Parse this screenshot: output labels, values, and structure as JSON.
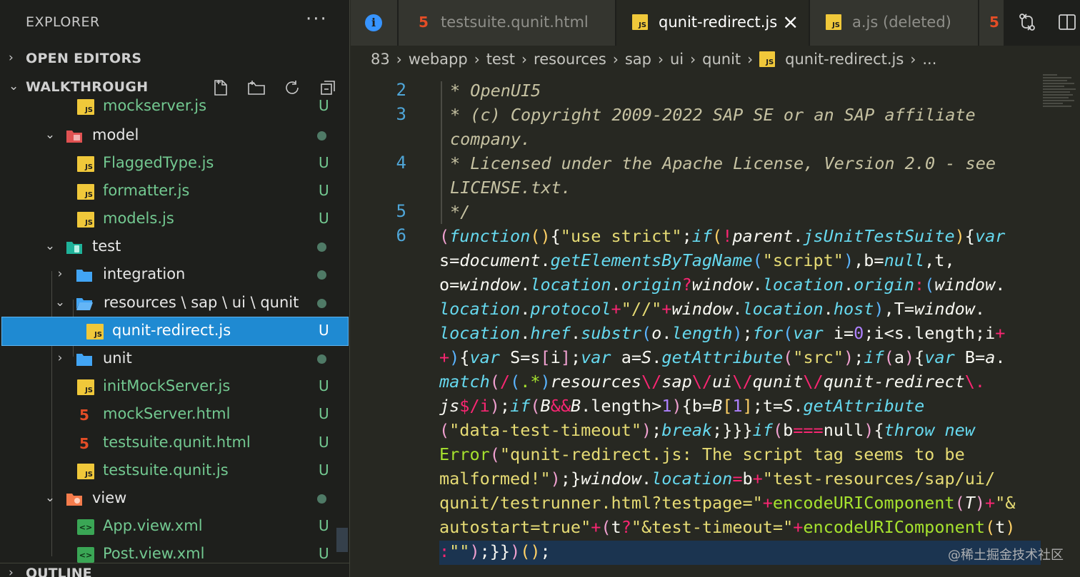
{
  "sidebar": {
    "title": "EXPLORER",
    "more": "···",
    "open_editors": "OPEN EDITORS",
    "workspace": "WALKTHROUGH",
    "outline": "OUTLINE",
    "tree": [
      {
        "name": "mockserver.js",
        "badge": "U"
      },
      {
        "name": "model",
        "badge": ""
      },
      {
        "name": "FlaggedType.js",
        "badge": "U"
      },
      {
        "name": "formatter.js",
        "badge": "U"
      },
      {
        "name": "models.js",
        "badge": "U"
      },
      {
        "name": "test",
        "badge": ""
      },
      {
        "name": "integration",
        "badge": ""
      },
      {
        "name": "resources \\ sap \\ ui \\ qunit",
        "badge": ""
      },
      {
        "name": "qunit-redirect.js",
        "badge": "U"
      },
      {
        "name": "unit",
        "badge": ""
      },
      {
        "name": "initMockServer.js",
        "badge": "U"
      },
      {
        "name": "mockServer.html",
        "badge": "U"
      },
      {
        "name": "testsuite.qunit.html",
        "badge": "U"
      },
      {
        "name": "testsuite.qunit.js",
        "badge": "U"
      },
      {
        "name": "view",
        "badge": ""
      },
      {
        "name": "App.view.xml",
        "badge": "U"
      },
      {
        "name": "Post.view.xml",
        "badge": "U"
      }
    ]
  },
  "tabs": [
    {
      "label": "testsuite.qunit.html",
      "type": "html"
    },
    {
      "label": "qunit-redirect.js",
      "type": "js",
      "active": true
    },
    {
      "label": "a.js (deleted)",
      "type": "js"
    }
  ],
  "breadcrumb": [
    "83",
    "webapp",
    "test",
    "resources",
    "sap",
    "ui",
    "qunit",
    "qunit-redirect.js",
    "..."
  ],
  "editor": {
    "line_numbers": [
      "2",
      "3",
      "4",
      "5",
      "6"
    ],
    "header_comment": [
      "* OpenUI5",
      "* (c) Copyright 2009-2022 SAP SE or an SAP affiliate",
      "company.",
      "* Licensed under the Apache License, Version 2.0 - see",
      "LICENSE.txt.",
      "*/"
    ]
  },
  "watermark": "@稀土掘金技术社区",
  "colors": {
    "accent": "#1f8ad2",
    "untracked": "#73c991",
    "background": "#272822"
  }
}
